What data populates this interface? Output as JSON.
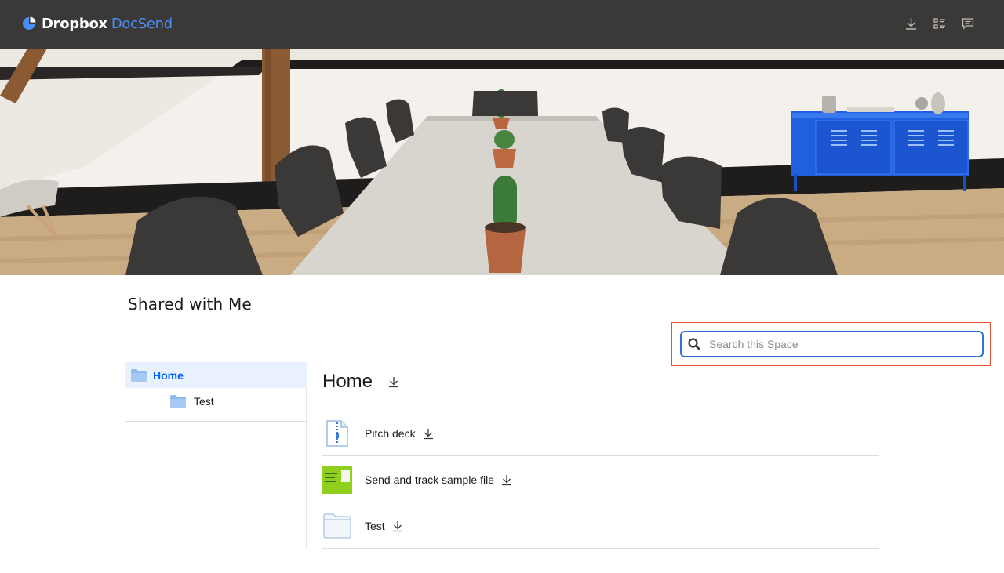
{
  "header": {
    "brand_name": "Dropbox",
    "brand_product": "DocSend",
    "brand_color": "#4a8ef7",
    "bar_color": "#3b3938",
    "actions": [
      {
        "icon": "download-icon"
      },
      {
        "icon": "list-view-icon"
      },
      {
        "icon": "chat-icon"
      }
    ]
  },
  "banner": {
    "icon": "conference-room-photo"
  },
  "page": {
    "title": "Shared with Me"
  },
  "search": {
    "placeholder": "Search this Space",
    "value": "",
    "highlight_color": "#e4512f"
  },
  "sidebar": {
    "items": [
      {
        "label": "Home",
        "selected": true,
        "icon": "folder-icon"
      },
      {
        "label": "Test",
        "selected": false,
        "icon": "folder-icon"
      }
    ],
    "selected_color": "#0061fe"
  },
  "main": {
    "title": "Home",
    "files": [
      {
        "name": "Pitch deck",
        "icon": "zip-file-icon"
      },
      {
        "name": "Send and track sample file",
        "icon": "document-thumbnail"
      },
      {
        "name": "Test",
        "icon": "folder-outline-icon"
      }
    ]
  }
}
